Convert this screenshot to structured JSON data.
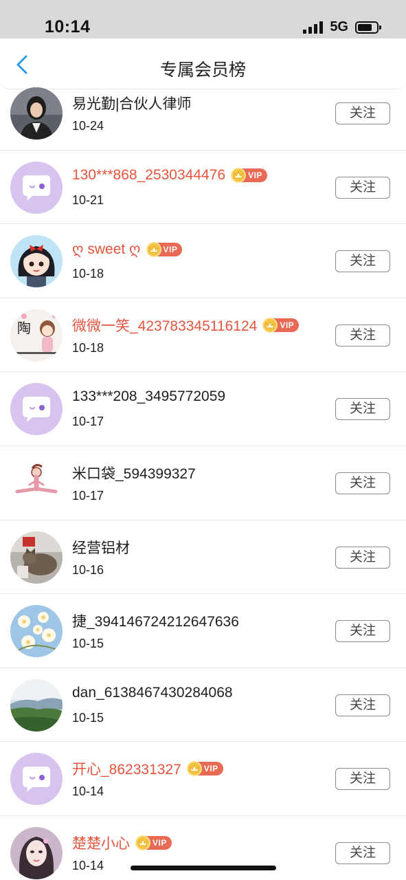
{
  "status_bar": {
    "time": "10:14",
    "network": "5G"
  },
  "header": {
    "title": "专属会员榜",
    "back_icon": "chevron-left-icon"
  },
  "colors": {
    "vip_name": "#e5543d",
    "accent_blue": "#2a9be8",
    "vip_badge": "#e86a55",
    "default_avatar": "#d7c3f0"
  },
  "members": [
    {
      "name": "易光勤|合伙人律师",
      "date": "10-24",
      "vip": false,
      "vip_label": "",
      "follow_label": "关注",
      "avatar": "photo-woman-suit"
    },
    {
      "name": "130***868_2530344476",
      "date": "10-21",
      "vip": true,
      "vip_label": "VIP",
      "follow_label": "关注",
      "avatar": "default-chat-avatar"
    },
    {
      "name": "ღ sweet ღ",
      "date": "10-18",
      "vip": true,
      "vip_label": "VIP",
      "follow_label": "关注",
      "avatar": "cartoon-girl"
    },
    {
      "name": "微微一笑_423783345116124",
      "date": "10-18",
      "vip": true,
      "vip_label": "VIP",
      "follow_label": "关注",
      "avatar": "cartoon-sticker"
    },
    {
      "name": "133***208_3495772059",
      "date": "10-17",
      "vip": false,
      "vip_label": "",
      "follow_label": "关注",
      "avatar": "default-chat-avatar"
    },
    {
      "name": "米口袋_594399327",
      "date": "10-17",
      "vip": false,
      "vip_label": "",
      "follow_label": "关注",
      "avatar": "stick-figure-split"
    },
    {
      "name": "经营铝材",
      "date": "10-16",
      "vip": false,
      "vip_label": "",
      "follow_label": "关注",
      "avatar": "photo-cat"
    },
    {
      "name": "捷_394146724212647636",
      "date": "10-15",
      "vip": false,
      "vip_label": "",
      "follow_label": "关注",
      "avatar": "photo-flowers"
    },
    {
      "name": "dan_6138467430284068",
      "date": "10-15",
      "vip": false,
      "vip_label": "",
      "follow_label": "关注",
      "avatar": "photo-landscape"
    },
    {
      "name": "开心_862331327",
      "date": "10-14",
      "vip": true,
      "vip_label": "VIP",
      "follow_label": "关注",
      "avatar": "default-chat-avatar"
    },
    {
      "name": "楚楚小心",
      "date": "10-14",
      "vip": true,
      "vip_label": "VIP",
      "follow_label": "关注",
      "avatar": "illustrated-woman"
    }
  ]
}
